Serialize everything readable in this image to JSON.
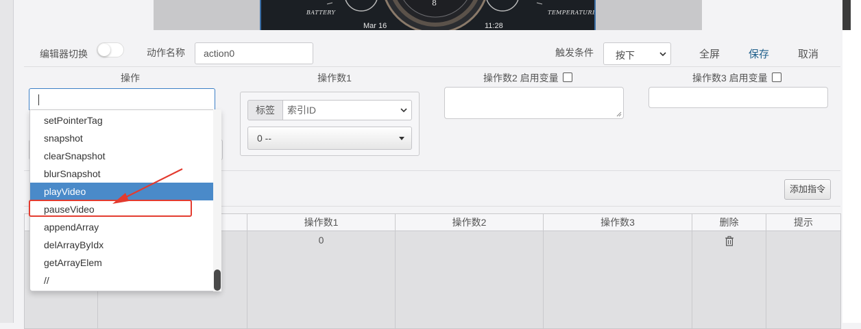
{
  "preview": {
    "battery_label": "BATTERY",
    "temperature_label": "TEMPERATURE",
    "date": "Mar  16",
    "time": "11:28",
    "gauge_digit": "8"
  },
  "toolbar": {
    "editor_toggle_label": "编辑器切换",
    "action_name_label": "动作名称",
    "action_name_value": "action0",
    "trigger_label": "触发条件",
    "trigger_value": "按下",
    "fullscreen_label": "全屏",
    "save_label": "保存",
    "cancel_label": "取消"
  },
  "columns": {
    "operation": "操作",
    "operand1": "操作数1",
    "operand2": "操作数2 启用变量",
    "operand3": "操作数3 启用变量"
  },
  "operand1": {
    "tag_label": "标签",
    "index_placeholder": "索引ID",
    "value_select": "0 --"
  },
  "dropdown": {
    "items": [
      "setPointerTag",
      "snapshot",
      "clearSnapshot",
      "blurSnapshot",
      "playVideo",
      "pauseVideo",
      "appendArray",
      "delArrayByIdx",
      "getArrayElem",
      "//"
    ],
    "selected_index": 4,
    "highlighted_item": "pauseVideo"
  },
  "add_command_label": "添加指令",
  "table": {
    "headers": [
      "",
      "",
      "操作数1",
      "操作数2",
      "操作数3",
      "删除",
      "提示"
    ],
    "rows": [
      {
        "operand1": "0",
        "operand2": "",
        "operand3": "",
        "delete_icon": "trash-icon",
        "hint": ""
      }
    ]
  },
  "colors": {
    "accent": "#4a8ac9",
    "save": "#1f5f8b",
    "annotation": "#e33b2f"
  }
}
